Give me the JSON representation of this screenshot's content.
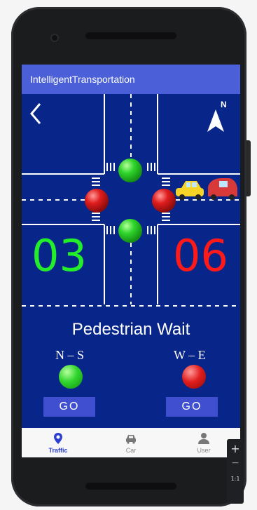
{
  "app": {
    "title": "IntelligentTransportation"
  },
  "header": {
    "back_icon": "chevron-left-icon",
    "compass_icon": "north-arrow-icon",
    "compass_label": "N"
  },
  "timers": {
    "ns": "03",
    "we": "06"
  },
  "colors": {
    "green": "#22ee2a",
    "red": "#ff1a1a",
    "background": "#08268a",
    "appbar": "#4a5fd8",
    "button": "#3f4fd0"
  },
  "pedestrian": {
    "title": "Pedestrian Wait",
    "ns_label": "N – S",
    "we_label": "W – E",
    "ns_state": "green",
    "we_state": "red",
    "go_label": "GO"
  },
  "nav": [
    {
      "label": "Traffic",
      "icon": "location-pin-icon",
      "active": true
    },
    {
      "label": "Car",
      "icon": "car-icon",
      "active": false
    },
    {
      "label": "User",
      "icon": "user-icon",
      "active": false
    }
  ],
  "zoom_controls": {
    "zoom_in": "+",
    "zoom_out": "−",
    "actual_size": "1:1"
  }
}
